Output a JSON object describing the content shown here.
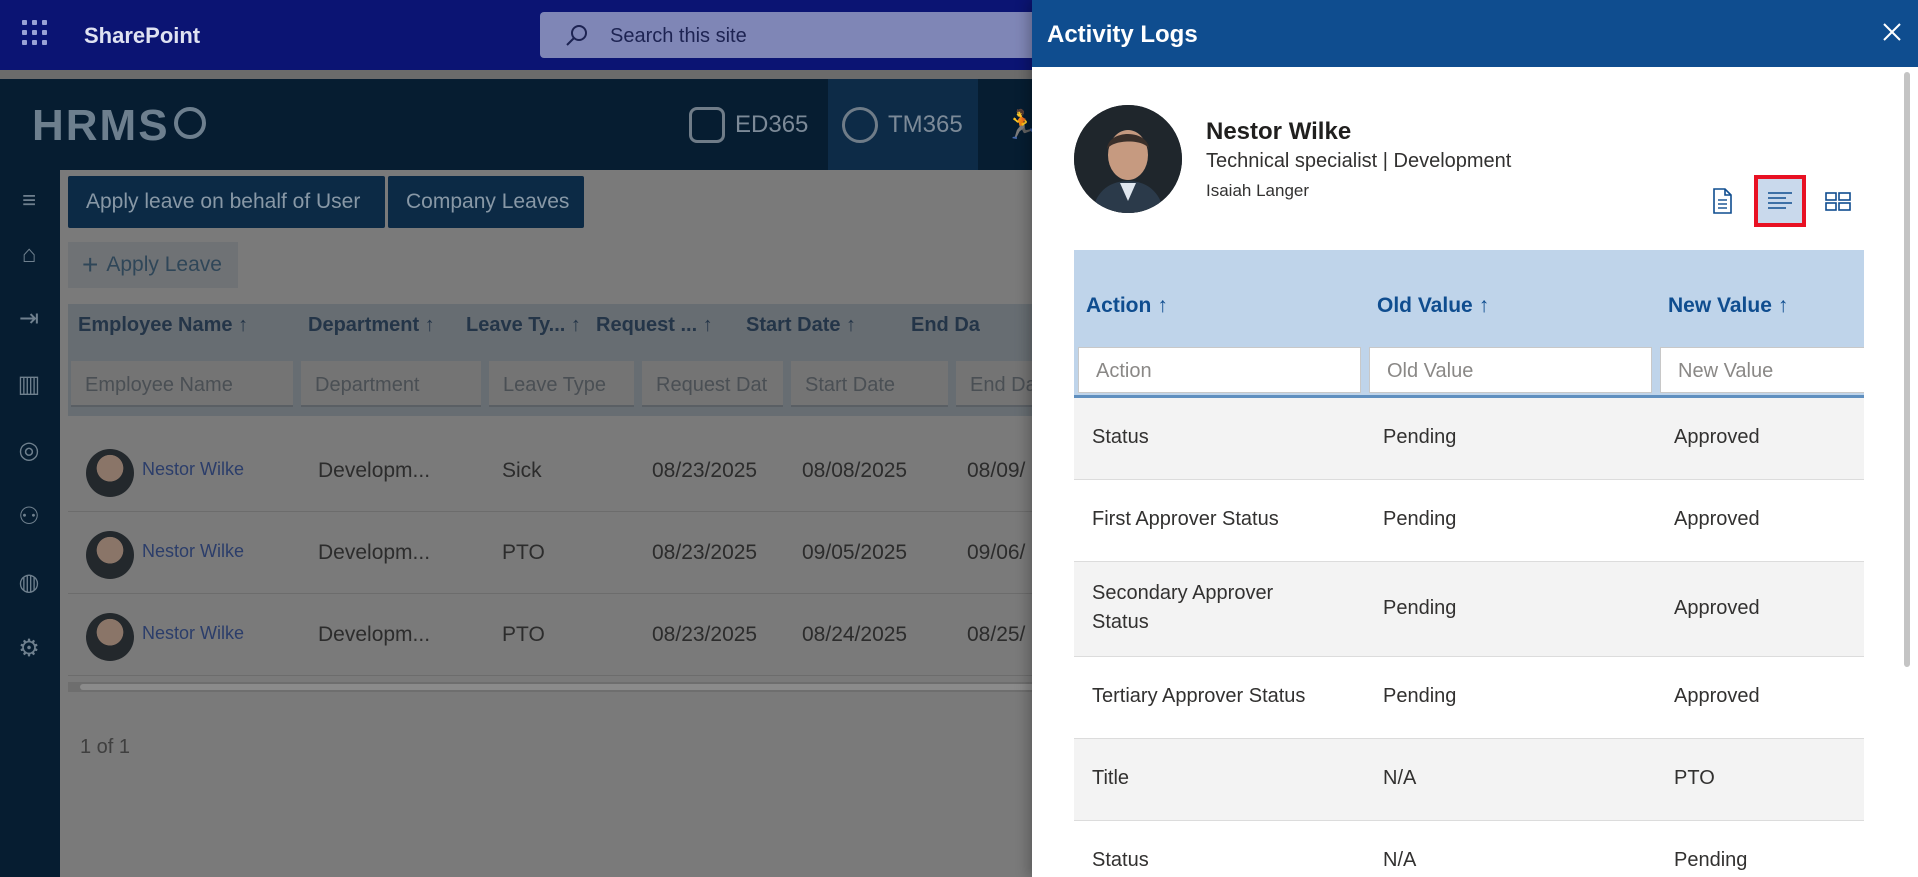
{
  "topbar": {
    "app_name": "SharePoint",
    "search_placeholder": "Search this site"
  },
  "hrms": {
    "logo": "HRMS",
    "apps": [
      {
        "label": "ED365",
        "active": false
      },
      {
        "label": "TM365",
        "active": true
      }
    ]
  },
  "toolbar": {
    "apply_behalf": "Apply leave on behalf of User",
    "company_leaves": "Company Leaves",
    "apply_leave": "Apply Leave"
  },
  "grid": {
    "columns": [
      "Employee Name ↑",
      "Department ↑",
      "Leave Ty... ↑",
      "Request ... ↑",
      "Start Date ↑",
      "End Da"
    ],
    "filters": [
      "Employee Name",
      "Department",
      "Leave Type",
      "Request Dat",
      "Start Date",
      "End Da"
    ],
    "rows": [
      {
        "name": "Nestor Wilke",
        "department": "Developm...",
        "leave_type": "Sick",
        "request": "08/23/2025",
        "start": "08/08/2025",
        "end": "08/09/"
      },
      {
        "name": "Nestor Wilke",
        "department": "Developm...",
        "leave_type": "PTO",
        "request": "08/23/2025",
        "start": "09/05/2025",
        "end": "09/06/"
      },
      {
        "name": "Nestor Wilke",
        "department": "Developm...",
        "leave_type": "PTO",
        "request": "08/23/2025",
        "start": "08/24/2025",
        "end": "08/25/"
      }
    ],
    "pager": "1 of 1"
  },
  "panel": {
    "title": "Activity Logs",
    "profile": {
      "name": "Nestor Wilke",
      "title": "Technical specialist | Development",
      "manager": "Isaiah Langer"
    },
    "columns": [
      {
        "label": "Action",
        "arrow": "↑",
        "filter": "Action"
      },
      {
        "label": "Old Value",
        "arrow": "↑",
        "filter": "Old Value"
      },
      {
        "label": "New Value",
        "arrow": "↑",
        "filter": "New Value"
      }
    ],
    "rows": [
      {
        "action": "Status",
        "old": "Pending",
        "new": "Approved"
      },
      {
        "action": "First Approver Status",
        "old": "Pending",
        "new": "Approved"
      },
      {
        "action": "Secondary Approver Status",
        "old": "Pending",
        "new": "Approved"
      },
      {
        "action": "Tertiary Approver Status",
        "old": "Pending",
        "new": "Approved"
      },
      {
        "action": "Title",
        "old": "N/A",
        "new": "PTO"
      },
      {
        "action": "Status",
        "old": "N/A",
        "new": "Pending"
      }
    ],
    "view_buttons": [
      {
        "icon": "document-icon",
        "active": false
      },
      {
        "icon": "text-align-left-icon",
        "active": true
      },
      {
        "icon": "grid-layout-icon",
        "active": false
      }
    ],
    "highlight_color": "#e81123",
    "header_color": "#0f4d8f"
  }
}
